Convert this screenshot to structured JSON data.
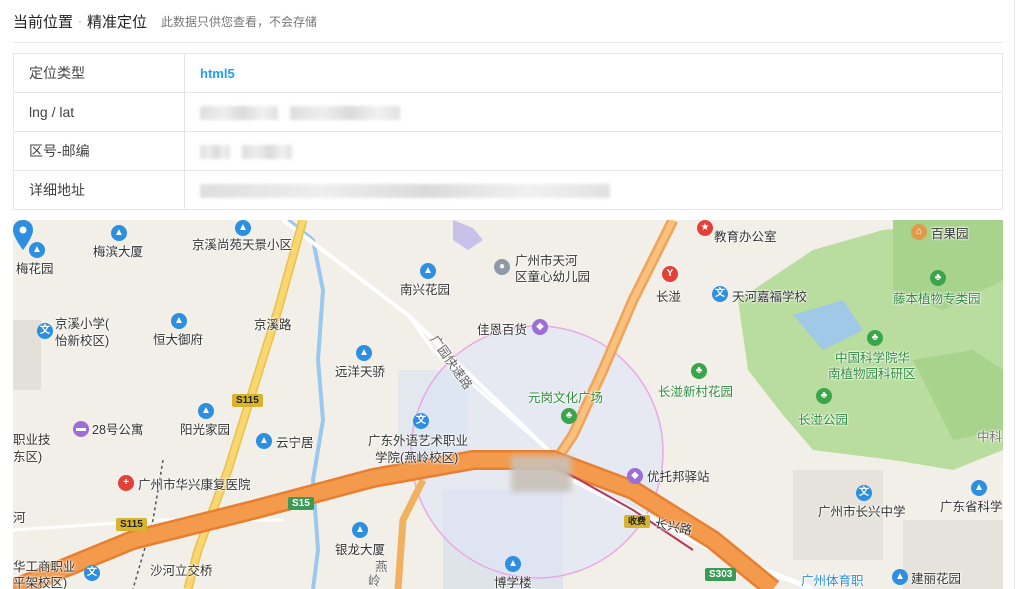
{
  "header": {
    "title": "当前位置",
    "separator": "·",
    "subtitle": "精准定位",
    "note": "此数据只供您查看，不会存储"
  },
  "info": {
    "rows": [
      {
        "key": "定位类型",
        "value": "html5"
      },
      {
        "key": "lng / lat",
        "value": ""
      },
      {
        "key": "区号-邮编",
        "value": ""
      },
      {
        "key": "详细地址",
        "value": ""
      }
    ]
  },
  "map": {
    "labels": {
      "meibin": "梅滨大厦",
      "jingxi_shangyuan": "京溪尚苑天景小区",
      "meihuayuan": "梅花园",
      "jingxi_school": "京溪小学(",
      "jingxi_school2": "怡新校区)",
      "hengda": "恒大御府",
      "jingxi_road": "京溪路",
      "nanxing": "南兴花园",
      "tianhe_kinder": "广州市天河",
      "tianhe_kinder2": "区童心幼儿园",
      "edu_office": "教育办公室",
      "changban": "长湴",
      "tianhe_jiafu": "天河嘉福学校",
      "baiguoyuan": "百果园",
      "tengben": "藤本植物专类园",
      "yuanyang": "远洋天骄",
      "jiaen": "佳恩百货",
      "yuangang_plaza": "元岗文化广场",
      "changban_xincun": "长湴新村花园",
      "kexue_yuan": "中国科学院华",
      "kexue_yuan2": "南植物园科研区",
      "changban_park": "长湴公园",
      "zhiye_ji": "职业技",
      "zhiye_ji2": "东区)",
      "apt28": "28号公寓",
      "yangguang": "阳光家园",
      "yunning": "云宁居",
      "guangwai": "广东外语艺术职业",
      "guangwai2": "学院(燕岭校区)",
      "zhongke": "中科",
      "youtuo": "优托邦驿站",
      "huaxing": "广州市华兴康复医院",
      "changxing_school": "广州市长兴中学",
      "gd_sci": "广东省科学",
      "he": "河",
      "changxing_road": "长兴路",
      "yinlong": "银龙大厦",
      "huagong": "华工商职业",
      "huagong2": "平架校区)",
      "shahe_bridge": "沙河立交桥",
      "boxuelou": "博学楼",
      "tiyu": "广州体育职",
      "jianli": "建丽花园",
      "guangyuan_road": "广园快速路",
      "yan_road": "燕",
      "ling_road": "岭",
      "toll": "收费",
      "s115a": "S115",
      "s115b": "S115",
      "s15": "S15",
      "s303": "S303"
    },
    "colors": {
      "expressway": "#f39a4d",
      "trunk": "#f6c55a",
      "park": "#b9dd9e",
      "water": "#9cc7ee",
      "accuracy_circle": "#c9d6f5"
    }
  }
}
